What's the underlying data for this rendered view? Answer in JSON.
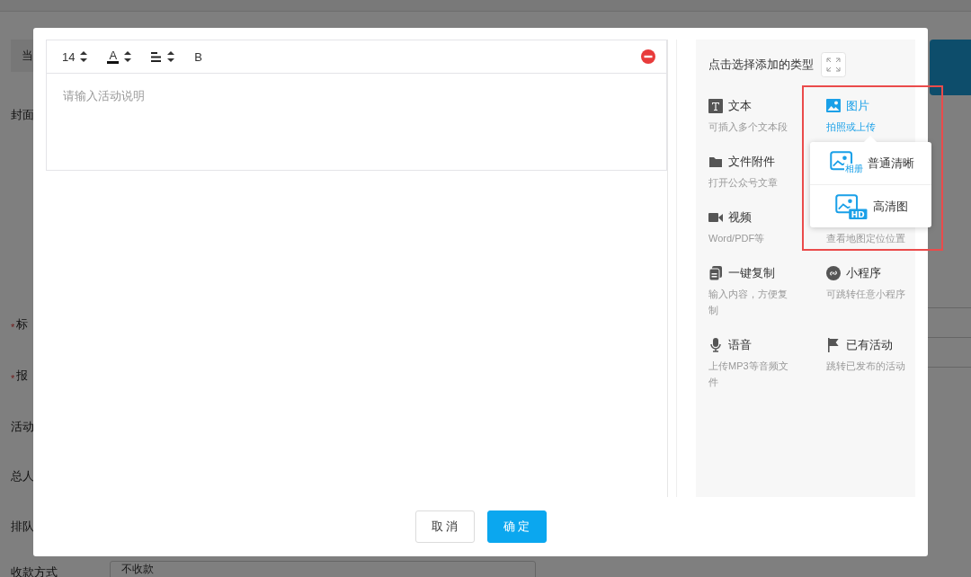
{
  "background": {
    "search_text": "当",
    "labels": [
      {
        "text": "封面",
        "required": false
      },
      {
        "text": "标",
        "required": true,
        "mark": "*"
      },
      {
        "text": "报",
        "required": true,
        "mark": "*"
      },
      {
        "text": "活动",
        "required": false
      },
      {
        "text": "总人",
        "required": false
      },
      {
        "text": "排队",
        "required": false
      },
      {
        "text": "收款方式",
        "required": false
      }
    ],
    "payment_field": "不收款"
  },
  "dialog": {
    "editor": {
      "font_size": "14",
      "color_label": "A",
      "bold_label": "B",
      "placeholder": "请输入活动说明"
    },
    "panel": {
      "title": "点击选择添加的类型",
      "items": [
        {
          "kind": "text",
          "title": "文本",
          "desc": "可插入多个文本段",
          "selected": false
        },
        {
          "kind": "image",
          "title": "图片",
          "desc": "拍照或上传",
          "selected": true
        },
        {
          "kind": "file",
          "title": "文件附件",
          "desc": "打开公众号文章",
          "selected": false
        },
        {
          "kind": "covered"
        },
        {
          "kind": "video",
          "title": "视频",
          "desc": "Word/PDF等",
          "selected": false
        },
        {
          "kind": "map",
          "desc": "查看地图定位位置",
          "selected": false
        },
        {
          "kind": "copy",
          "title": "一键复制",
          "desc": "输入内容，方便复制",
          "selected": false
        },
        {
          "kind": "miniapp",
          "title": "小程序",
          "desc": "可跳转任意小程序",
          "selected": false
        },
        {
          "kind": "audio",
          "title": "语音",
          "desc": "上传MP3等音频文件",
          "selected": false
        },
        {
          "kind": "activity",
          "title": "已有活动",
          "desc": "跳转已发布的活动",
          "selected": false
        }
      ],
      "popup": [
        {
          "kind": "normal",
          "label": "普通清晰",
          "badge": "相册"
        },
        {
          "kind": "hd",
          "label": "高清图",
          "badge": "HD"
        }
      ]
    },
    "buttons": [
      {
        "kind": "cancel",
        "label": "取 消"
      },
      {
        "kind": "confirm",
        "label": "确 定"
      }
    ]
  }
}
